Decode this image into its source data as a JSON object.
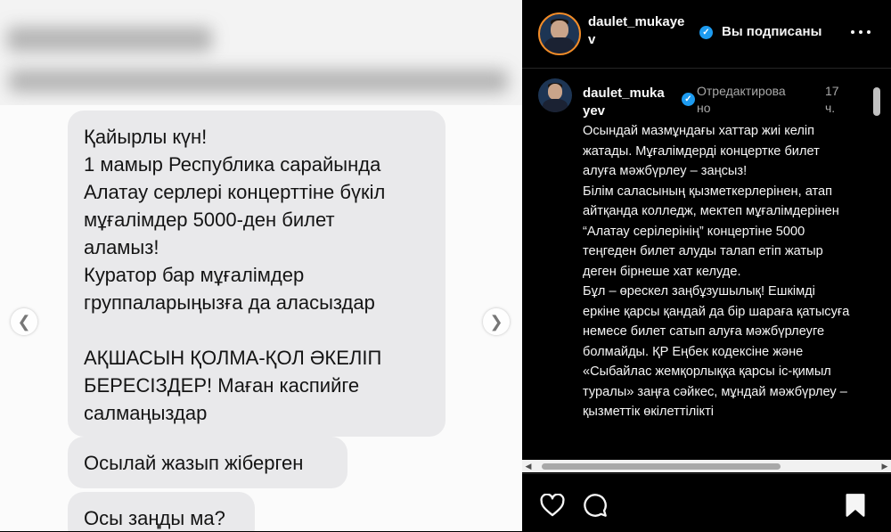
{
  "media": {
    "messages": [
      {
        "text": "Қайырлы күн!\n1 мамыр Республика сарайында\nАлатау серлері концерттіне бүкіл\nмұғалімдер 5000-ден билет\nаламыз!\nКуратор бар мұғалімдер\nгруппаларыңызға да аласыздар\n\nАҚШАСЫН ҚОЛМА-ҚОЛ ӘКЕЛІП\nБЕРЕСІЗДЕР! Маған каспийге\nсалмаңыздар"
      },
      {
        "text": "Осылай жазып жіберген"
      },
      {
        "text": "Осы заңды ма?"
      }
    ],
    "prev_icon": "chevron-left-icon",
    "next_icon": "chevron-right-icon"
  },
  "post": {
    "header": {
      "username": "daulet_mukaye\nv",
      "follow_status": "Вы подписаны",
      "more_icon": "more-horizontal-icon"
    },
    "caption": {
      "username": "daulet_muka\nyev",
      "edited_label": "Отредактирова\nно",
      "time": "17\nч.",
      "text": "Осындай мазмұндағы хаттар жиі келіп жатады. Мұғалімдерді концертке билет алуға мәжбүрлеу – заңсыз!\nБілім саласының қызметкерлерінен, атап айтқанда колледж, мектеп мұғалімдерінен “Алатау серілерінің” концертіне 5000 теңгеден билет алуды талап етіп жатыр деген бірнеше хат келуде.\nБұл – өрескел заңбұзушылық! Ешкімді еркіне қарсы қандай да бір шараға қатысуға немесе билет сатып алуға мәжбүрлеуге болмайды. ҚР Еңбек кодексіне және «Сыбайлас жемқорлыққа қарсы іс-қимыл туралы» заңға сәйкес, мұндай мәжбүрлеу – қызметтік өкілеттілікті"
    },
    "actions": {
      "like_icon": "heart-icon",
      "comment_icon": "comment-icon",
      "save_icon": "bookmark-icon"
    }
  },
  "colors": {
    "panel_bg": "#000000",
    "bubble_bg": "#e9e9eb",
    "verified": "#1d9bf0",
    "meta_text": "#a8a8a8"
  }
}
